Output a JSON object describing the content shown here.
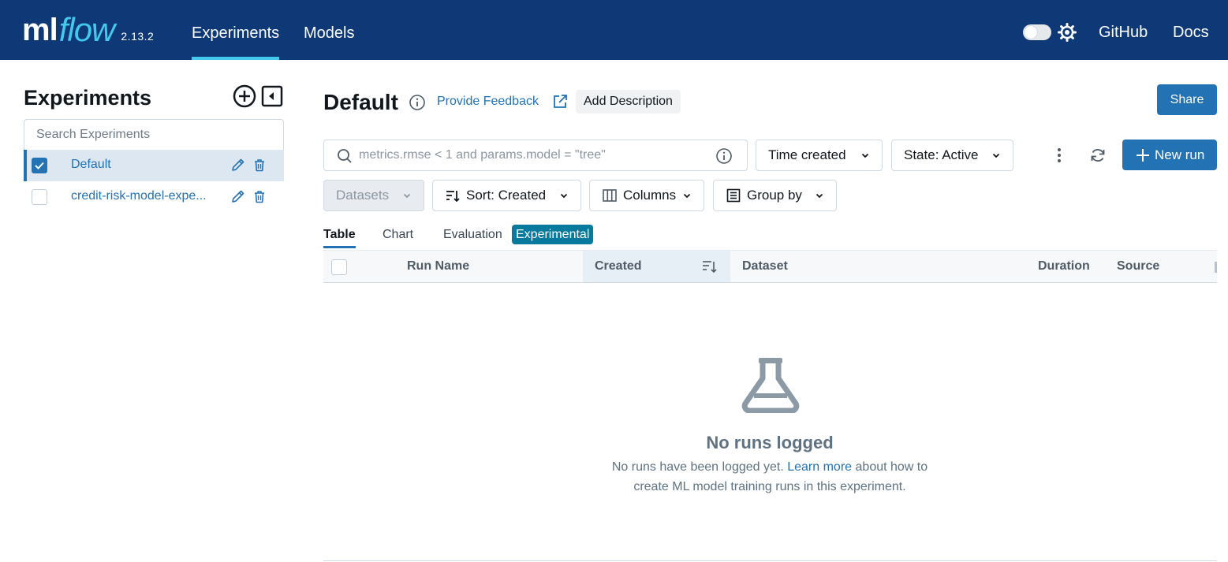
{
  "header": {
    "logo_ml": "ml",
    "logo_flow": "flow",
    "version": "2.13.2",
    "nav": [
      {
        "label": "Experiments",
        "active": true
      },
      {
        "label": "Models",
        "active": false
      }
    ],
    "github_label": "GitHub",
    "docs_label": "Docs",
    "dark_mode_enabled": false
  },
  "sidebar": {
    "title": "Experiments",
    "search_placeholder": "Search Experiments",
    "experiments": [
      {
        "name": "Default",
        "checked": true
      },
      {
        "name": "credit-risk-model-expe...",
        "checked": false
      }
    ]
  },
  "main": {
    "title": "Default",
    "feedback_label": "Provide Feedback",
    "add_description_label": "Add Description",
    "share_label": "Share",
    "search_placeholder": "metrics.rmse < 1 and params.model = \"tree\"",
    "time_filter_label": "Time created",
    "state_filter_label": "State: Active",
    "new_run_label": "New run",
    "datasets_label": "Datasets",
    "sort_label": "Sort: Created",
    "columns_label": "Columns",
    "group_by_label": "Group by",
    "tabs": [
      {
        "label": "Table",
        "active": true
      },
      {
        "label": "Chart",
        "active": false
      },
      {
        "label": "Evaluation",
        "active": false
      }
    ],
    "evaluation_badge": "Experimental",
    "table_columns": [
      "Run Name",
      "Created",
      "Dataset",
      "Duration",
      "Source"
    ],
    "empty_title": "No runs logged",
    "empty_text_before": "No runs have been logged yet.",
    "empty_link": "Learn more",
    "empty_text_after1": "about how to",
    "empty_text_after2": "create ML model training runs in this experiment."
  },
  "colors": {
    "nav_bg": "#0e3876",
    "accent": "#43c9ed",
    "primary": "#2272b4",
    "badge": "#077a9d"
  },
  "icons": [
    "gear-icon",
    "add-experiment-icon",
    "collapse-sidebar-icon",
    "edit-icon",
    "trash-icon",
    "info-icon",
    "external-link-icon",
    "search-icon",
    "kebab-menu-icon",
    "refresh-icon",
    "plus-icon",
    "sort-icon",
    "columns-icon",
    "group-by-icon",
    "flask-icon",
    "chevron-down-icon"
  ]
}
